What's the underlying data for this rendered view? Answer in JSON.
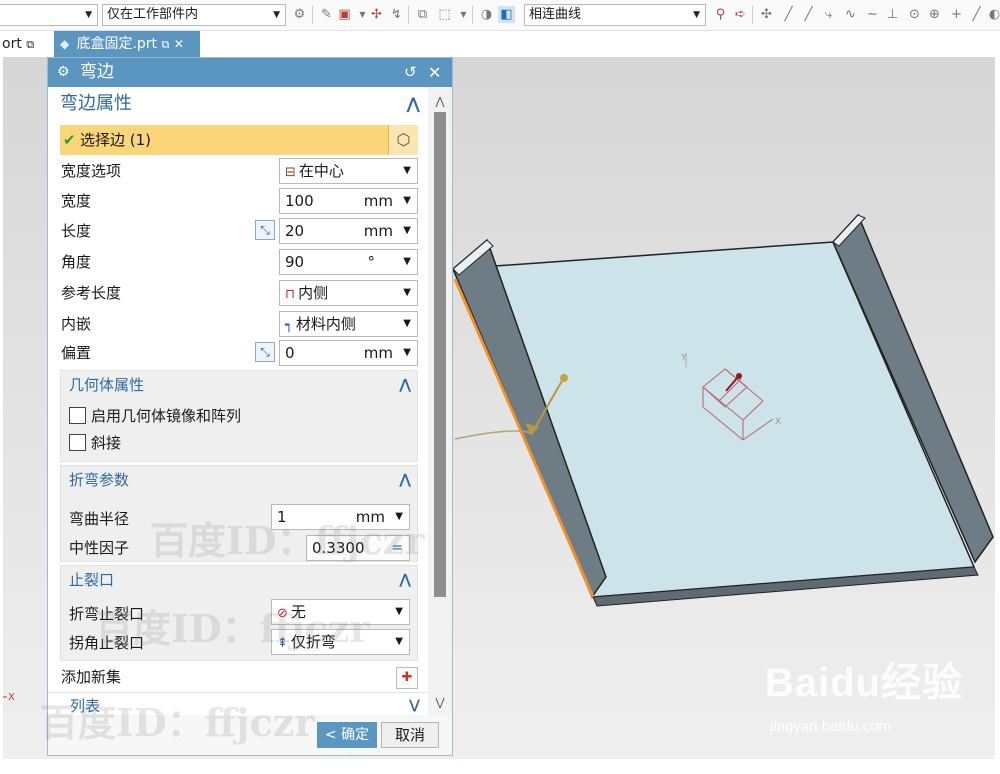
{
  "toolbar": {
    "filter_select": "仅在工作部件内",
    "curve_rule_select": "相连曲线"
  },
  "tabs": {
    "prev_label": "ort",
    "active_label": "底盒固定.prt"
  },
  "dialog": {
    "title": "弯边",
    "section_title": "弯边属性",
    "select_edge": "选择边 (1)",
    "width_option": {
      "label": "宽度选项",
      "value": "在中心",
      "icon": "center-icon"
    },
    "width": {
      "label": "宽度",
      "value": "100",
      "unit": "mm"
    },
    "length": {
      "label": "长度",
      "value": "20",
      "unit": "mm"
    },
    "angle": {
      "label": "角度",
      "value": "90",
      "unit": "°"
    },
    "ref_length": {
      "label": "参考长度",
      "value": "内侧",
      "icon": "inner-icon"
    },
    "inset": {
      "label": "内嵌",
      "value": "材料内侧",
      "icon": "material-inside-icon"
    },
    "offset": {
      "label": "偏置",
      "value": "0",
      "unit": "mm"
    },
    "geometry": {
      "title": "几何体属性",
      "mirror_label": "启用几何体镜像和阵列",
      "mirror_checked": false,
      "miter_label": "斜接",
      "miter_checked": false
    },
    "bend": {
      "title": "折弯参数",
      "radius_label": "弯曲半径",
      "radius_value": "1",
      "radius_unit": "mm",
      "neutral_label": "中性因子",
      "neutral_value": "0.3300",
      "neutral_btn": "="
    },
    "relief": {
      "title": "止裂口",
      "bend_relief_label": "折弯止裂口",
      "bend_relief_value": "无",
      "corner_relief_label": "拐角止裂口",
      "corner_relief_value": "仅折弯"
    },
    "add_new_set": "添加新集",
    "list_label": "列表",
    "ok_label": "< 确定 >",
    "cancel_label": "取消"
  },
  "watermarks": [
    "百度ID：ffjczr",
    "百度ID：ffjczr",
    "百度ID：ffjczr"
  ],
  "brand": {
    "logo": "Baidu经验",
    "url": "jingyan.baidu.com"
  }
}
